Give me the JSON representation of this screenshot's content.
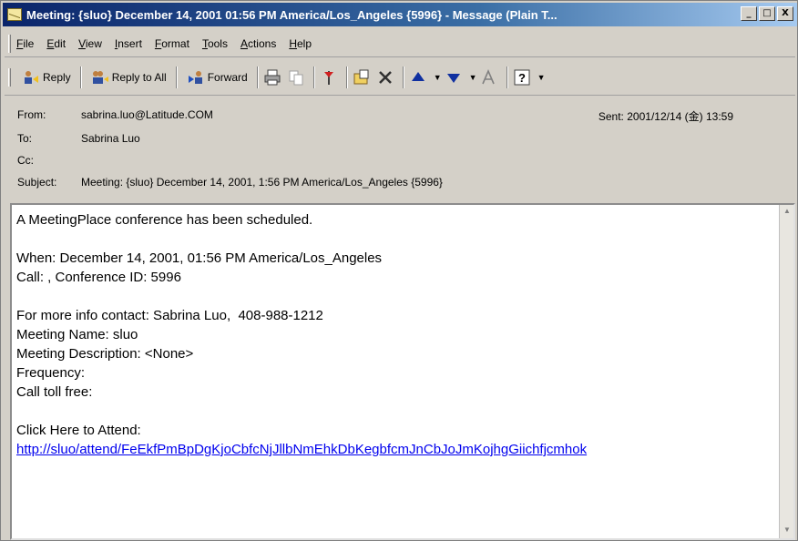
{
  "window": {
    "title": "Meeting: {sluo} December 14, 2001 01:56 PM America/Los_Angeles {5996} - Message (Plain T...",
    "controls": {
      "minimize": "_",
      "maximize": "□",
      "close": "X"
    }
  },
  "menu": [
    "File",
    "Edit",
    "View",
    "Insert",
    "Format",
    "Tools",
    "Actions",
    "Help"
  ],
  "toolbar": {
    "reply": "Reply",
    "reply_all": "Reply to All",
    "forward": "Forward"
  },
  "header": {
    "from_label": "From:",
    "from_value": "sabrina.luo@Latitude.COM",
    "to_label": "To:",
    "to_value": "Sabrina Luo",
    "cc_label": "Cc:",
    "cc_value": "",
    "subject_label": "Subject:",
    "subject_value": "Meeting: {sluo} December 14, 2001, 1:56 PM America/Los_Angeles {5996}",
    "sent_label": "Sent:",
    "sent_value": "2001/12/14 (金) 13:59"
  },
  "body": {
    "line1": "A MeetingPlace conference has been scheduled.",
    "when": "When: December 14, 2001, 01:56 PM America/Los_Angeles",
    "call": "Call: , Conference ID: 5996",
    "contact": "For more info contact: Sabrina Luo,  408-988-1212",
    "meeting_name": "Meeting Name: sluo",
    "meeting_desc": "Meeting Description: <None>",
    "frequency": "Frequency:",
    "toll_free": "Call toll free:",
    "click_here": "Click Here to Attend:",
    "link": "http://sluo/attend/FeEkfPmBpDgKjoCbfcNjJllbNmEhkDbKegbfcmJnCbJoJmKojhgGiichfjcmhok"
  },
  "colors": {
    "titlebar_start": "#0a246a",
    "titlebar_end": "#a6caf0",
    "link": "#0000ee",
    "chrome": "#d4d0c8"
  },
  "icons": [
    "mail-icon",
    "reply-icon",
    "reply-all-icon",
    "forward-icon",
    "print-icon",
    "copy-icon",
    "flag-icon",
    "move-icon",
    "delete-icon",
    "previous-icon",
    "next-icon",
    "font-size-icon",
    "help-icon"
  ]
}
